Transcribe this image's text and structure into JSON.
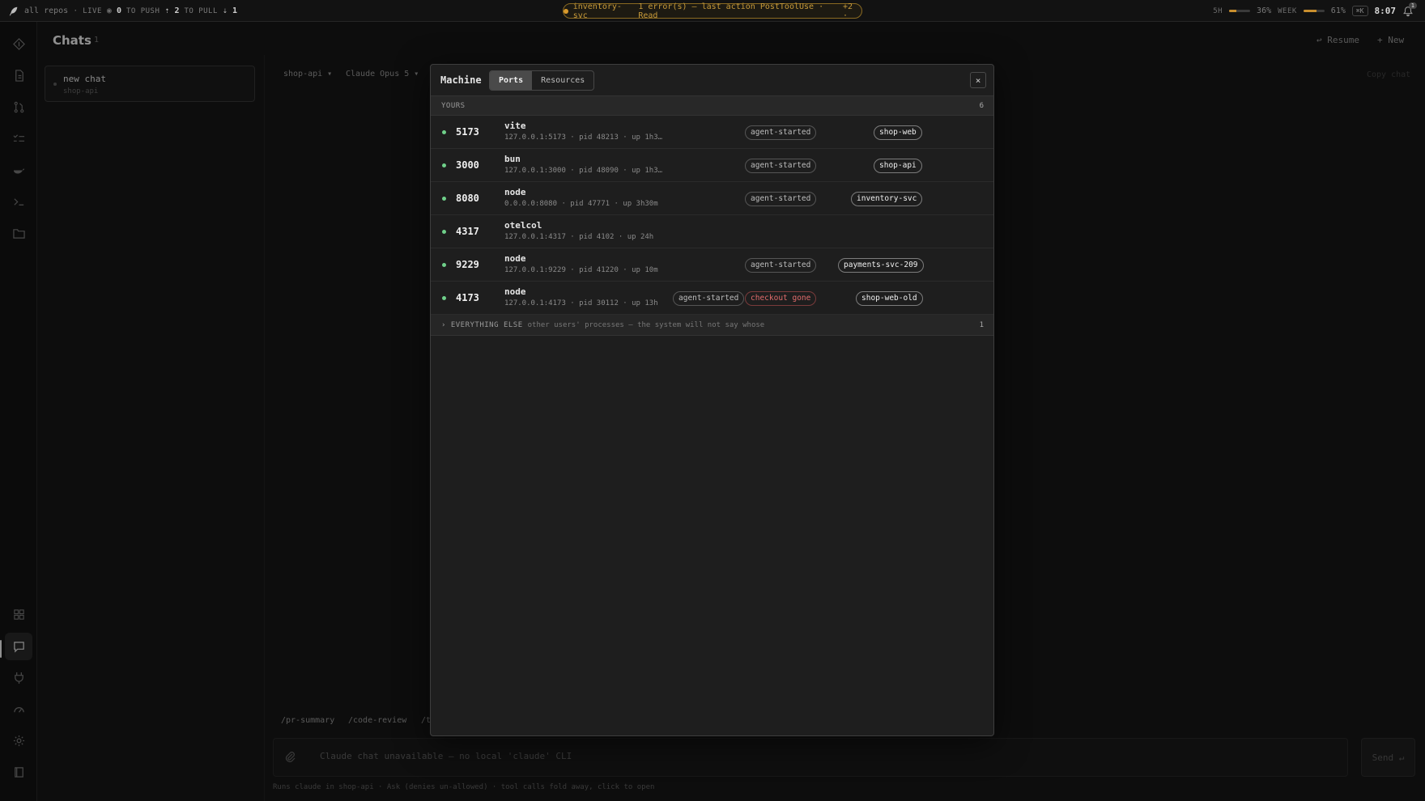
{
  "topbar": {
    "repos": "all repos",
    "live_label": "LIVE",
    "live_count": "0",
    "push_label": "TO PUSH",
    "push_count": "2",
    "pull_label": "TO PULL",
    "pull_count": "1",
    "alert_service": "inventory-svc",
    "alert_text": "1 error(s) — last action PostToolUse · Read",
    "alert_more": "+2 ·",
    "usage_5h_label": "5H",
    "usage_5h_value": "36%",
    "usage_5h_fraction": 0.36,
    "usage_week_label": "WEEK",
    "usage_week_value": "61%",
    "usage_week_fraction": 0.61,
    "shortcut": "⌘K",
    "clock": "8:07",
    "notif_count": "1",
    "accent_warning": "#d99a2c"
  },
  "chats": {
    "title": "Chats",
    "count": "1",
    "resume_label": "↩ Resume",
    "new_label": "+ New",
    "items": [
      {
        "title": "new chat",
        "repo": "shop-api"
      }
    ],
    "repo_select": "shop-api ▾",
    "model_select": "Claude Opus 5 ▾",
    "copy_label": "Copy chat",
    "commands": [
      "/pr-summary",
      "/code-review",
      "/t"
    ],
    "composer_placeholder": "Claude chat unavailable — no local 'claude' CLI",
    "send_label": "Send ↵",
    "footnote": "Runs claude in shop-api · Ask (denies un-allowed) · tool calls fold away, click to open"
  },
  "modal": {
    "title": "Machine",
    "tabs": [
      "Ports",
      "Resources"
    ],
    "active_tab": "Ports",
    "close_label": "×",
    "yours_label": "YOURS",
    "yours_count": "6",
    "ports": [
      {
        "port": "5173",
        "process": "vite",
        "meta": "127.0.0.1:5173 · pid 48213 · up 1h3…",
        "tags": [
          "agent-started"
        ],
        "repo": "shop-web"
      },
      {
        "port": "3000",
        "process": "bun",
        "meta": "127.0.0.1:3000 · pid 48090 · up 1h3…",
        "tags": [
          "agent-started"
        ],
        "repo": "shop-api"
      },
      {
        "port": "8080",
        "process": "node",
        "meta": "0.0.0.0:8080 · pid 47771 · up 3h30m",
        "tags": [
          "agent-started"
        ],
        "repo": "inventory-svc"
      },
      {
        "port": "4317",
        "process": "otelcol",
        "meta": "127.0.0.1:4317 · pid 4102 · up 24h",
        "tags": [],
        "repo": ""
      },
      {
        "port": "9229",
        "process": "node",
        "meta": "127.0.0.1:9229 · pid 41220 · up 10m",
        "tags": [
          "agent-started"
        ],
        "repo": "payments-svc-209"
      },
      {
        "port": "4173",
        "process": "node",
        "meta": "127.0.0.1:4173 · pid 30112 · up 13h",
        "tags": [
          "agent-started",
          "checkout gone"
        ],
        "repo": "shop-web-old"
      }
    ],
    "else_label": "› EVERYTHING ELSE",
    "else_sub": "other users' processes — the system will not say whose",
    "else_count": "1",
    "status_color": "#6fd08a",
    "danger_color": "#e26c6c"
  }
}
